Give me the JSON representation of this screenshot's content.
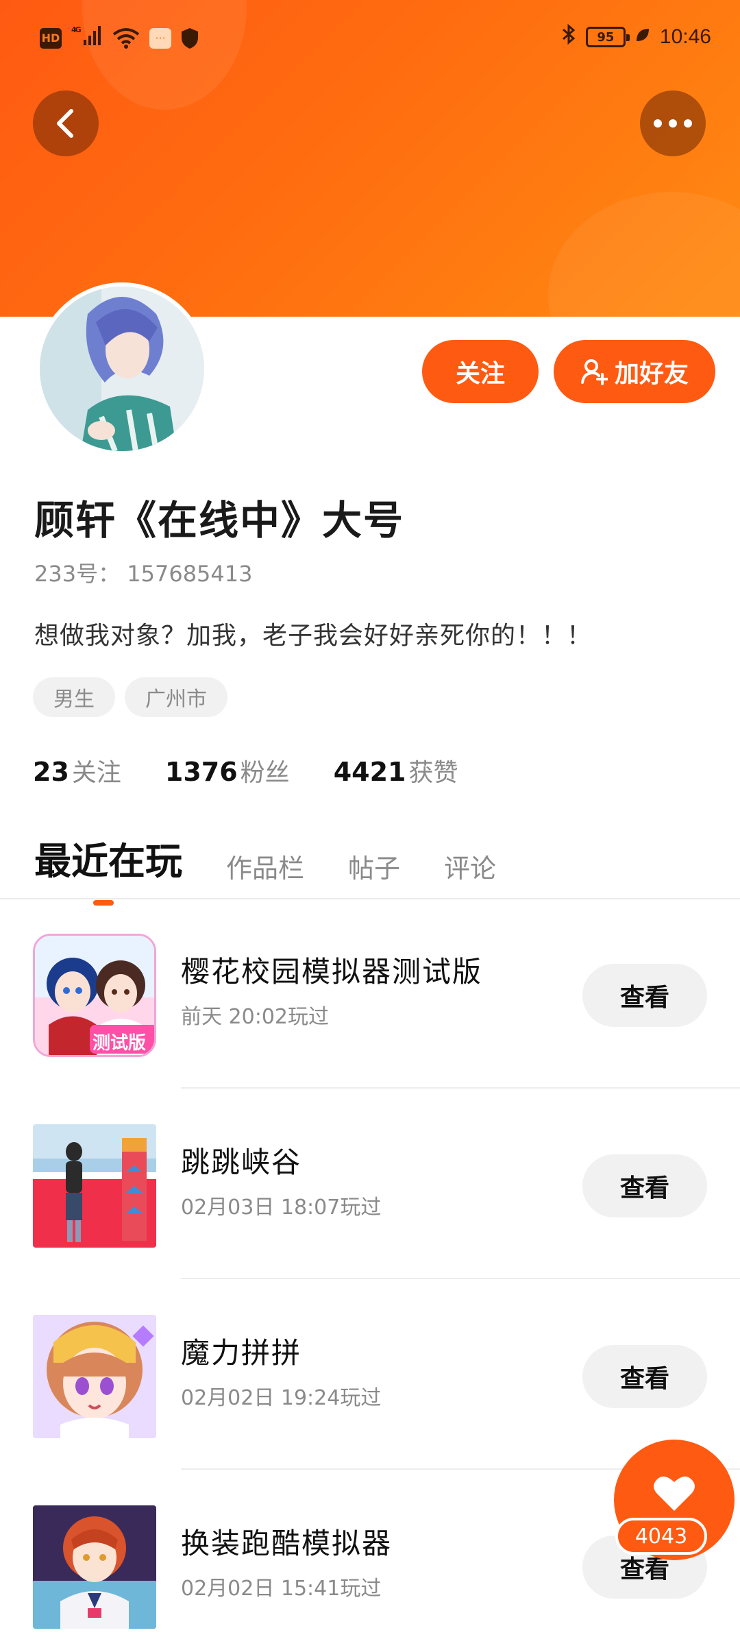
{
  "status_bar": {
    "hd": "HD",
    "network": "4G",
    "battery": "95",
    "time": "10:46"
  },
  "profile": {
    "name": "顾轩《在线中》大号",
    "id_text": "233号： 157685413",
    "bio": "想做我对象？加我，老子我会好好亲死你的！！！",
    "tags": [
      "男生",
      "广州市"
    ],
    "follow_label": "关注",
    "add_friend_label": "加好友"
  },
  "stats": [
    {
      "num": "23",
      "label": "关注"
    },
    {
      "num": "1376",
      "label": "粉丝"
    },
    {
      "num": "4421",
      "label": "获赞"
    }
  ],
  "tabs": [
    {
      "label": "最近在玩",
      "active": true
    },
    {
      "label": "作品栏",
      "active": false
    },
    {
      "label": "帖子",
      "active": false
    },
    {
      "label": "评论",
      "active": false
    }
  ],
  "games": [
    {
      "title": "樱花校园模拟器测试版",
      "time": "前天 20:02玩过",
      "button": "查看",
      "icon_badge": "测试版"
    },
    {
      "title": "跳跳峡谷",
      "time": "02月03日 18:07玩过",
      "button": "查看"
    },
    {
      "title": "魔力拼拼",
      "time": "02月02日 19:24玩过",
      "button": "查看"
    },
    {
      "title": "换装跑酷模拟器",
      "time": "02月02日 15:41玩过",
      "button": "查看"
    }
  ],
  "like_fab": {
    "count": "4043"
  },
  "colors": {
    "accent": "#ff5a12",
    "banner_start": "#ff5a12",
    "banner_end": "#ff8b12",
    "muted_text": "#8a8a8a",
    "pill_bg": "#f1f1f1"
  },
  "icons": {
    "back": "back-arrow-icon",
    "more": "more-dots-icon",
    "add_friend": "add-user-icon",
    "like": "heart-icon"
  }
}
